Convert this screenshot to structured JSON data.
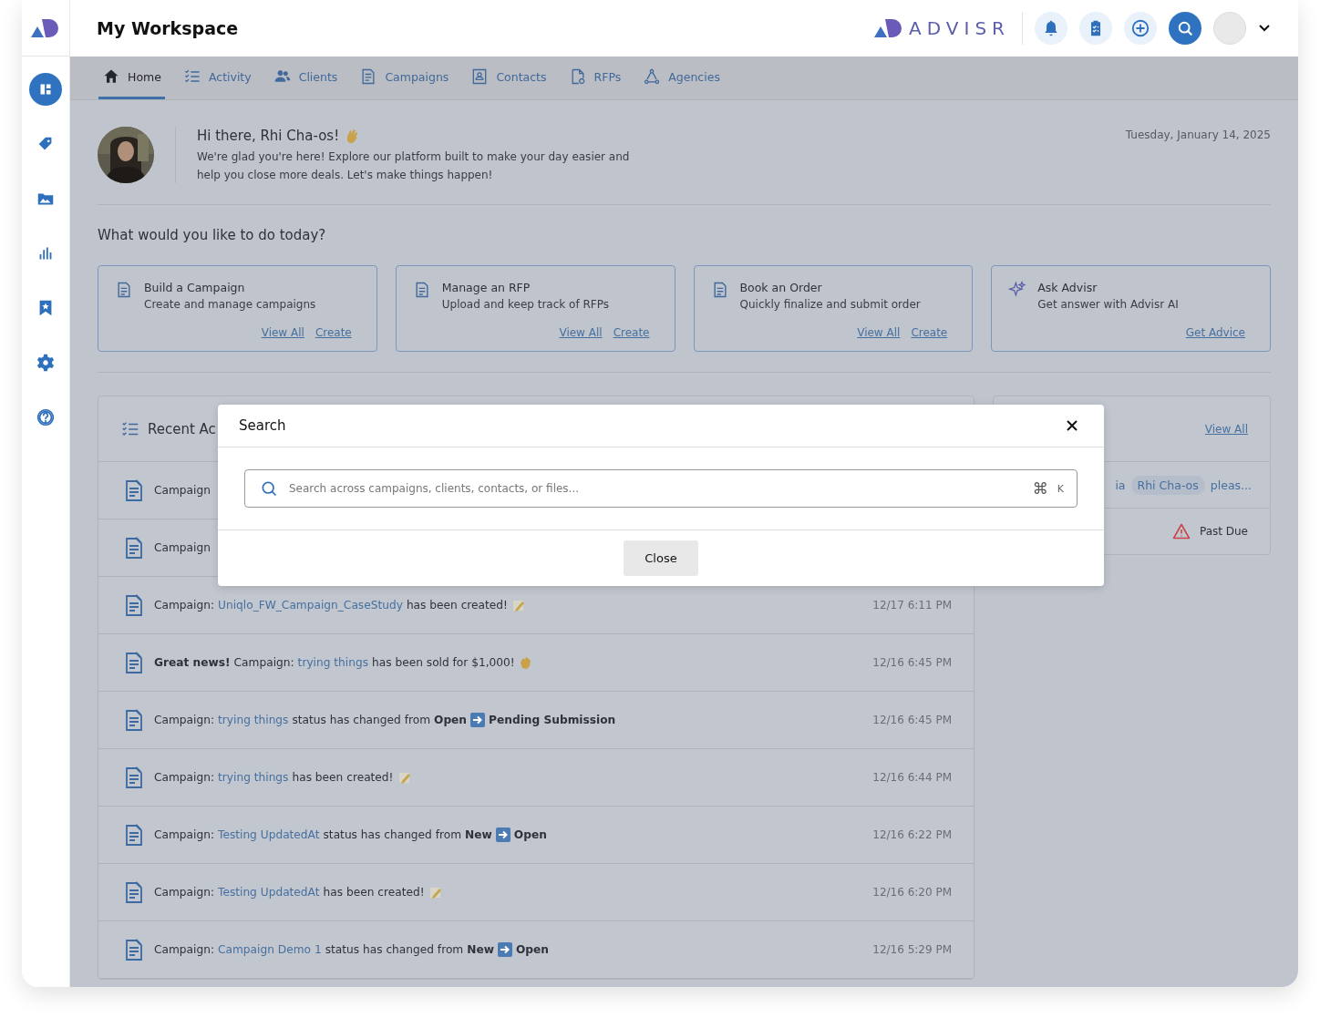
{
  "header": {
    "title": "My Workspace",
    "brand": "ADVISR"
  },
  "sidebar": {
    "items": [
      {
        "kind": "dashboard",
        "selected": true
      },
      {
        "kind": "tag",
        "selected": false
      },
      {
        "kind": "gallery",
        "selected": false
      },
      {
        "kind": "chart",
        "selected": false
      },
      {
        "kind": "bookmark",
        "selected": false
      },
      {
        "kind": "settings",
        "selected": false
      },
      {
        "kind": "help",
        "selected": false
      }
    ]
  },
  "nav_tabs": [
    {
      "label": "Home",
      "kind": "home",
      "selected": true
    },
    {
      "label": "Activity",
      "kind": "list",
      "selected": false
    },
    {
      "label": "Clients",
      "kind": "people",
      "selected": false
    },
    {
      "label": "Campaigns",
      "kind": "doc",
      "selected": false
    },
    {
      "label": "Contacts",
      "kind": "contact",
      "selected": false
    },
    {
      "label": "RFPs",
      "kind": "file",
      "selected": false
    },
    {
      "label": "Agencies",
      "kind": "network",
      "selected": false
    }
  ],
  "welcome": {
    "greeting": "Hi there, Rhi Cha-os!",
    "message": "We're glad you're here! Explore our platform built to make your day easier and help you close more deals. Let's make things happen!",
    "date": "Tuesday, January 14, 2025"
  },
  "prompt": "What would you like to do today?",
  "actions": [
    {
      "kind": "doc",
      "title": "Build a Campaign",
      "description": "Create and manage campaigns",
      "links": [
        "View All",
        "Create"
      ]
    },
    {
      "kind": "doc",
      "title": "Manage an RFP",
      "description": "Upload and keep track of RFPs",
      "links": [
        "View All",
        "Create"
      ]
    },
    {
      "kind": "doc",
      "title": "Book an Order",
      "description": "Quickly finalize and submit order",
      "links": [
        "View All",
        "Create"
      ]
    },
    {
      "kind": "sparkle",
      "title": "Ask Advisr",
      "description": "Get answer with Advisr AI",
      "links": [
        "Get Advice"
      ]
    }
  ],
  "recent_activity": {
    "title": "Recent Ac",
    "rows": [
      {
        "segments": [
          {
            "kind": "text",
            "text": "Campaign"
          }
        ]
      },
      {
        "segments": [
          {
            "kind": "text",
            "text": "Campaign"
          }
        ]
      },
      {
        "segments": [
          {
            "kind": "text",
            "text": "Campaign:"
          },
          {
            "kind": "link",
            "text": "Uniqlo_FW_Campaign_CaseStudy"
          },
          {
            "kind": "text",
            "text": "has been created!"
          },
          {
            "kind": "memo"
          }
        ],
        "time": "12/17 6:11 PM"
      },
      {
        "segments": [
          {
            "kind": "bold",
            "text": "Great news!"
          },
          {
            "kind": "text",
            "text": "Campaign:"
          },
          {
            "kind": "link",
            "text": "trying things"
          },
          {
            "kind": "text",
            "text": "has been sold for $1,000!"
          },
          {
            "kind": "clap"
          }
        ],
        "time": "12/16 6:45 PM"
      },
      {
        "segments": [
          {
            "kind": "text",
            "text": "Campaign:"
          },
          {
            "kind": "link",
            "text": "trying things"
          },
          {
            "kind": "text",
            "text": "status has changed from"
          },
          {
            "kind": "bold",
            "text": "Open"
          },
          {
            "kind": "arrow"
          },
          {
            "kind": "bold",
            "text": "Pending Submission"
          }
        ],
        "time": "12/16 6:45 PM"
      },
      {
        "segments": [
          {
            "kind": "text",
            "text": "Campaign:"
          },
          {
            "kind": "link",
            "text": "trying things"
          },
          {
            "kind": "text",
            "text": "has been created!"
          },
          {
            "kind": "memo"
          }
        ],
        "time": "12/16 6:44 PM"
      },
      {
        "segments": [
          {
            "kind": "text",
            "text": "Campaign:"
          },
          {
            "kind": "link",
            "text": "Testing UpdatedAt"
          },
          {
            "kind": "text",
            "text": "status has changed from"
          },
          {
            "kind": "bold",
            "text": "New"
          },
          {
            "kind": "arrow"
          },
          {
            "kind": "bold",
            "text": "Open"
          }
        ],
        "time": "12/16 6:22 PM"
      },
      {
        "segments": [
          {
            "kind": "text",
            "text": "Campaign:"
          },
          {
            "kind": "link",
            "text": "Testing UpdatedAt"
          },
          {
            "kind": "text",
            "text": "has been created!"
          },
          {
            "kind": "memo"
          }
        ],
        "time": "12/16 6:20 PM"
      },
      {
        "segments": [
          {
            "kind": "text",
            "text": "Campaign:"
          },
          {
            "kind": "link",
            "text": "Campaign Demo 1"
          },
          {
            "kind": "text",
            "text": "status has changed from"
          },
          {
            "kind": "bold",
            "text": "New"
          },
          {
            "kind": "arrow"
          },
          {
            "kind": "bold",
            "text": "Open"
          }
        ],
        "time": "12/16 5:29 PM"
      }
    ]
  },
  "side_panel": {
    "link": "View All",
    "mention": {
      "fragment": "ia",
      "chip": "Rhi Cha-os",
      "trailing": "pleas..."
    },
    "status": "Past Due"
  },
  "search_dialog": {
    "title": "Search",
    "placeholder": "Search across campaigns, clients, contacts, or files...",
    "shortcut_symbol": "⌘",
    "shortcut_key": "K",
    "button": "Close"
  }
}
